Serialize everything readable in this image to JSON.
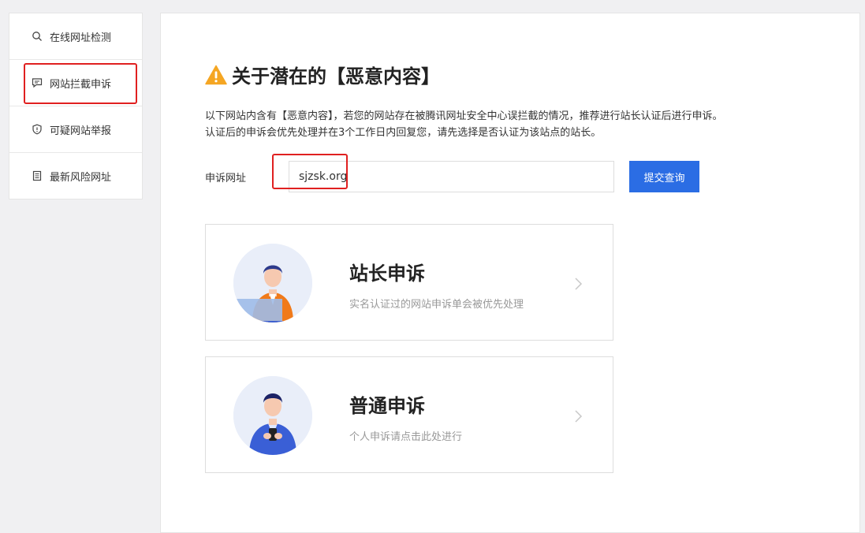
{
  "sidebar": {
    "items": [
      {
        "label": "在线网址检测",
        "icon": "search-icon"
      },
      {
        "label": "网站拦截申诉",
        "icon": "message-icon",
        "active": true
      },
      {
        "label": "可疑网站举报",
        "icon": "shield-icon"
      },
      {
        "label": "最新风险网址",
        "icon": "document-icon"
      }
    ]
  },
  "main": {
    "title": "关于潜在的【恶意内容】",
    "desc_line1": "以下网站内含有【恶意内容】，若您的网站存在被腾讯网址安全中心误拦截的情况，推荐进行站长认证后进行申诉。",
    "desc_line2": "认证后的申诉会优先处理并在3个工作日内回复您，请先选择是否认证为该站点的站长。",
    "url_label": "申诉网址",
    "url_value": "sjzsk.org",
    "submit_label": "提交查询"
  },
  "cards": [
    {
      "title": "站长申诉",
      "subtitle": "实名认证过的网站申诉单会被优先处理"
    },
    {
      "title": "普通申诉",
      "subtitle": "个人申诉请点击此处进行"
    }
  ],
  "colors": {
    "accent": "#2b6de4",
    "highlight": "#e02020",
    "warning": "#f5a623"
  }
}
